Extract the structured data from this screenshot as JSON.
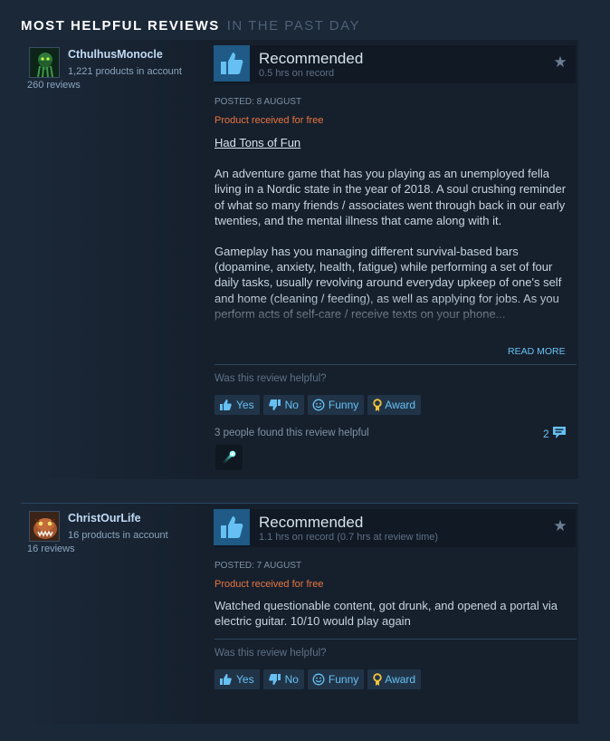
{
  "section": {
    "title": "MOST HELPFUL REVIEWS",
    "subtitle": "IN THE PAST DAY"
  },
  "reviews": [
    {
      "author": {
        "name": "CthulhusMonocle",
        "products": "1,221 products in account",
        "reviews": "260 reviews"
      },
      "recommendation": "Recommended",
      "hours": "0.5 hrs on record",
      "posted": "POSTED: 8 AUGUST",
      "free_notice": "Product received for free",
      "heading": "Had Tons of Fun",
      "paragraphs": [
        "An adventure game that has you playing as an unemployed fella living in a Nordic state in the year of 2018. A soul crushing reminder of what so many friends / associates went through back in our early twenties, and the mental illness that came along with it.",
        "Gameplay has you managing different survival-based bars (dopamine, anxiety, health, fatigue) while performing a set of four daily tasks, usually revolving around everyday upkeep of one's self and home (cleaning / feeding), as well as applying for jobs. As you perform acts of self-care / receive texts on your phone..."
      ],
      "read_more": "READ MORE",
      "helpful_question": "Was this review helpful?",
      "buttons": {
        "yes": "Yes",
        "no": "No",
        "funny": "Funny",
        "award": "Award"
      },
      "found_helpful": "3 people found this review helpful",
      "comment_count": "2",
      "award_icon": "rocket-award-icon"
    },
    {
      "author": {
        "name": "ChristOurLife",
        "products": "16 products in account",
        "reviews": "16 reviews"
      },
      "recommendation": "Recommended",
      "hours": "1.1 hrs on record (0.7 hrs at review time)",
      "posted": "POSTED: 7 AUGUST",
      "free_notice": "Product received for free",
      "paragraphs": [
        "Watched questionable content, got drunk, and opened a portal via electric guitar. 10/10 would play again"
      ],
      "helpful_question": "Was this review helpful?",
      "buttons": {
        "yes": "Yes",
        "no": "No",
        "funny": "Funny",
        "award": "Award"
      }
    }
  ],
  "colors": {
    "background": "#1b2838",
    "panel": "#16202d",
    "accent_blue": "#66c0f4",
    "free_orange": "#e9743f",
    "thumb_box": "#1f5b86"
  }
}
